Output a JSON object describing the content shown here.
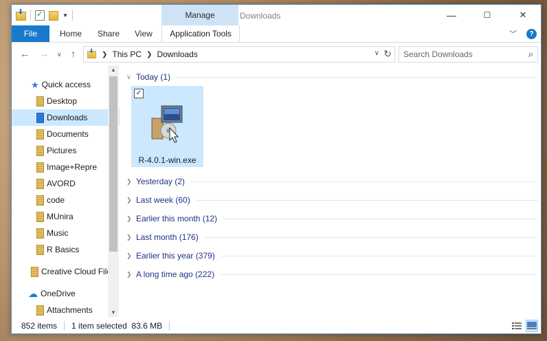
{
  "window": {
    "title": "Downloads",
    "context_tab": "Manage",
    "minimize": "—",
    "maximize": "☐",
    "close": "✕"
  },
  "ribbon": {
    "tabs": [
      "File",
      "Home",
      "Share",
      "View",
      "Application Tools"
    ],
    "help": "?"
  },
  "address": {
    "crumbs": [
      "This PC",
      "Downloads"
    ],
    "search_placeholder": "Search Downloads"
  },
  "sidebar": {
    "items": [
      {
        "label": "Quick access",
        "icon": "star-icon",
        "pinned": false
      },
      {
        "label": "Desktop",
        "icon": "folder-icon",
        "pinned": true
      },
      {
        "label": "Downloads",
        "icon": "downloads-folder-icon",
        "pinned": true,
        "selected": true
      },
      {
        "label": "Documents",
        "icon": "folder-icon",
        "pinned": true
      },
      {
        "label": "Pictures",
        "icon": "folder-icon",
        "pinned": true
      },
      {
        "label": "Image+Repre",
        "icon": "folder-icon",
        "pinned": true
      },
      {
        "label": "AVORD",
        "icon": "folder-icon",
        "pinned": true
      },
      {
        "label": "code",
        "icon": "folder-icon",
        "pinned": false
      },
      {
        "label": "MUnira",
        "icon": "folder-icon",
        "pinned": false
      },
      {
        "label": "Music",
        "icon": "folder-icon",
        "pinned": false
      },
      {
        "label": "R Basics",
        "icon": "folder-icon",
        "pinned": false
      },
      {
        "label": "Creative Cloud File",
        "icon": "folder-icon",
        "pinned": false
      },
      {
        "label": "OneDrive",
        "icon": "cloud-icon",
        "pinned": false
      },
      {
        "label": "Attachments",
        "icon": "folder-icon",
        "pinned": false
      }
    ]
  },
  "content": {
    "groups": [
      {
        "label": "Today (1)",
        "expanded": true
      },
      {
        "label": "Yesterday (2)",
        "expanded": false
      },
      {
        "label": "Last week (60)",
        "expanded": false
      },
      {
        "label": "Earlier this month (12)",
        "expanded": false
      },
      {
        "label": "Last month (176)",
        "expanded": false
      },
      {
        "label": "Earlier this year (379)",
        "expanded": false
      },
      {
        "label": "A long time ago (222)",
        "expanded": false
      }
    ],
    "file": {
      "name": "R-4.0.1-win.exe",
      "checked": "✓"
    }
  },
  "status": {
    "item_count": "852 items",
    "selection": "1 item selected  83.6 MB"
  },
  "colors": {
    "accent": "#1979ca",
    "selection": "#cce8ff",
    "group_text": "#1e3287"
  }
}
